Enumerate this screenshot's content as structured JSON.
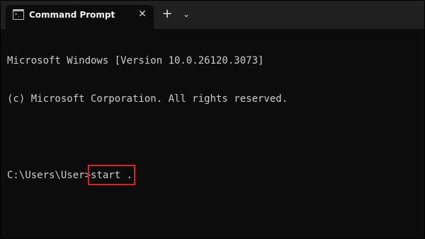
{
  "titlebar": {
    "tab_title": "Command Prompt",
    "tab_icon": "command-prompt-icon",
    "close_icon": "close-icon",
    "close_glyph": "✕",
    "new_tab_icon": "plus-icon",
    "new_tab_glyph": "+",
    "dropdown_icon": "chevron-down-icon",
    "dropdown_glyph": "⌄"
  },
  "console": {
    "lines": [
      "Microsoft Windows [Version 10.0.26120.3073]",
      "(c) Microsoft Corporation. All rights reserved."
    ],
    "prompt": "C:\\Users\\User>",
    "command": "start ."
  },
  "colors": {
    "background": "#0c0c0c",
    "titlebar": "#202020",
    "text": "#cccccc",
    "highlight": "#e02020"
  }
}
